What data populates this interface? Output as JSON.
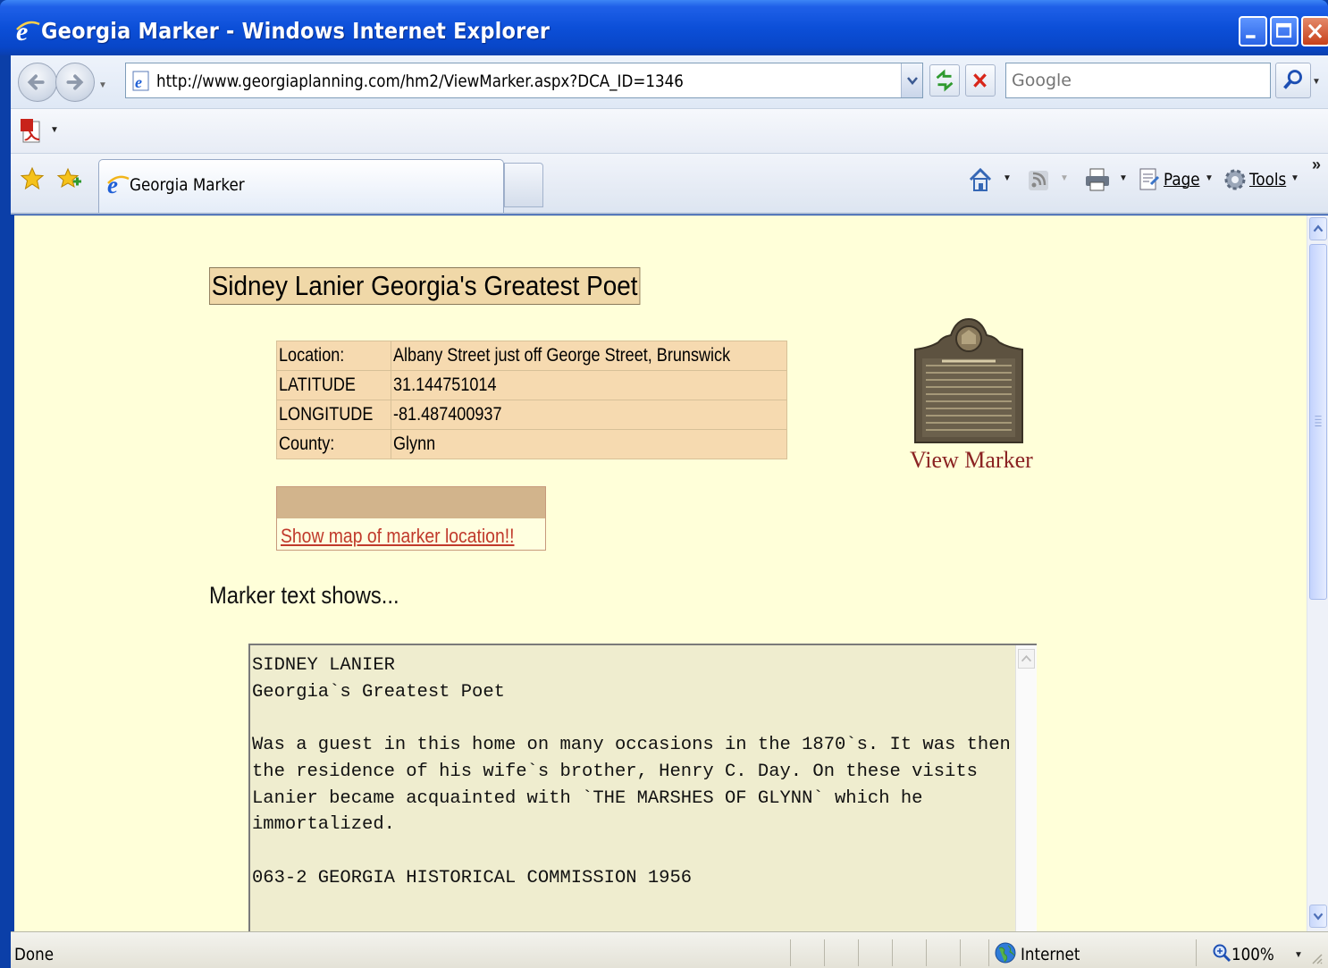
{
  "window": {
    "title": "Georgia Marker - Windows Internet Explorer"
  },
  "address": {
    "url": "http://www.georgiaplanning.com/hm2/ViewMarker.aspx?DCA_ID=1346",
    "search_placeholder": "Google"
  },
  "tabs": [
    {
      "label": "Georgia Marker"
    }
  ],
  "commands": {
    "page_label": "Page",
    "tools_label": "Tools"
  },
  "page": {
    "title": "Sidney Lanier Georgia's Greatest Poet",
    "info": [
      {
        "key": "Location:",
        "value": "Albany Street just off George Street, Brunswick"
      },
      {
        "key": "LATITUDE",
        "value": "31.144751014"
      },
      {
        "key": "LONGITUDE",
        "value": "-81.487400937"
      },
      {
        "key": "County:",
        "value": "Glynn"
      }
    ],
    "map_link": "Show map of marker location!!",
    "view_marker": "View Marker",
    "marker_heading": "Marker text shows...",
    "marker_text": "SIDNEY LANIER\nGeorgia`s Greatest Poet\n\nWas a guest in this home on many occasions in the 1870`s. It was then\nthe residence of his wife`s brother, Henry C. Day. On these visits\nLanier became acquainted with `THE MARSHES OF GLYNN` which he\nimmortalized.\n\n063-2 GEORGIA HISTORICAL COMMISSION 1956"
  },
  "status": {
    "text": "Done",
    "zone": "Internet",
    "zoom": "100%"
  },
  "colors": {
    "page_bg": "#ffffd9",
    "title_bg": "#f0d8a8",
    "table_bg": "#f6dab0",
    "link": "#c0392b",
    "view_marker": "#8b2323"
  },
  "icons": {
    "browser": "ie-logo-icon",
    "back": "back-arrow-icon",
    "forward": "forward-arrow-icon",
    "refresh": "refresh-icon",
    "stop": "stop-icon",
    "search": "search-icon",
    "pdf": "pdf-icon",
    "favorites": "favorites-star-icon",
    "add_favorite": "add-favorite-icon",
    "home": "home-icon",
    "feeds": "rss-feed-icon",
    "print": "print-icon",
    "page": "page-icon",
    "tools": "gear-icon",
    "zone": "globe-icon",
    "zoom": "zoom-icon"
  }
}
